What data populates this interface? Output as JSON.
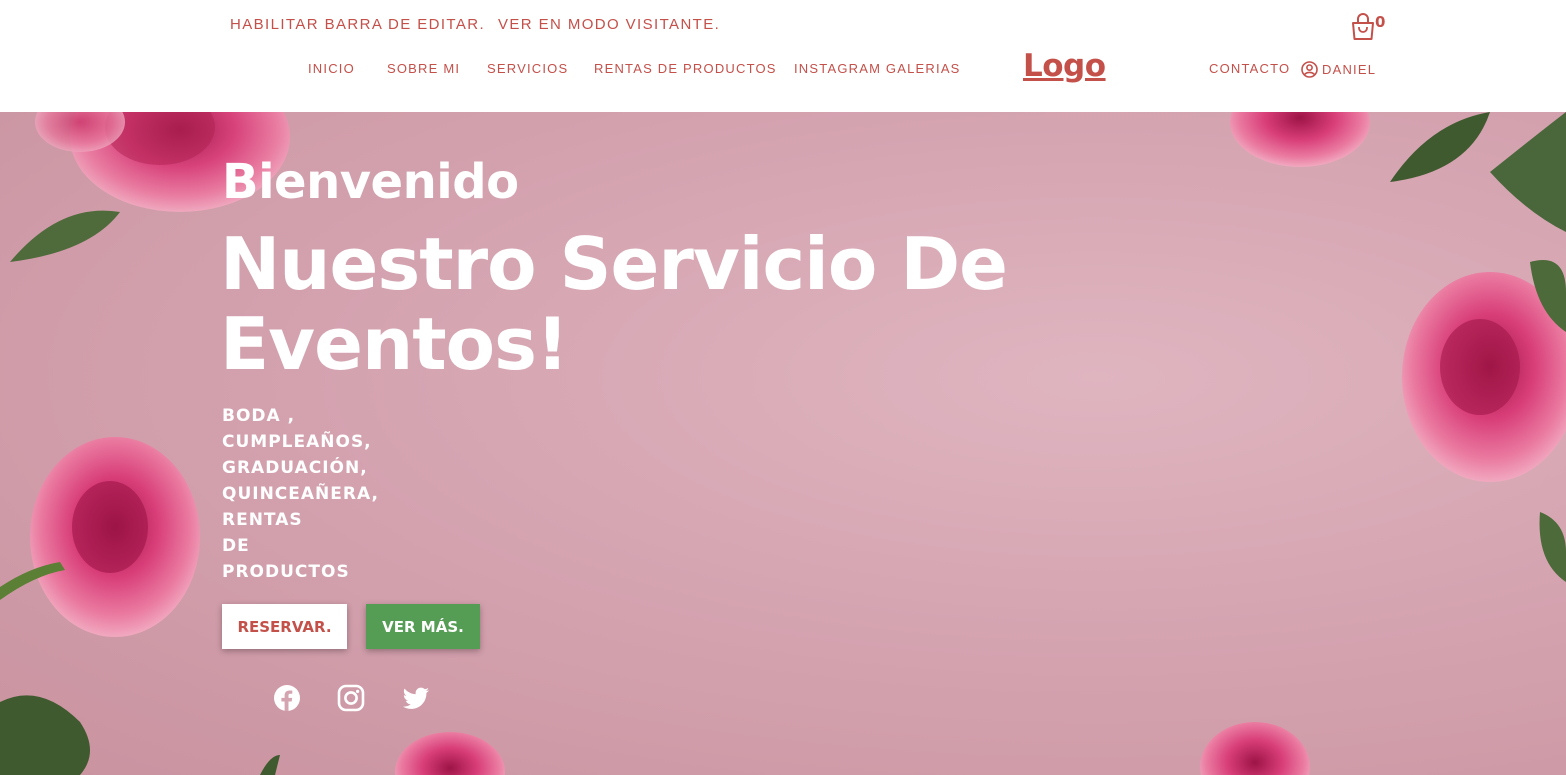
{
  "admin_bar": {
    "edit_label": "HABILITAR BARRA DE EDITAR.",
    "visitor_label": "VER EN MODO VISITANTE."
  },
  "nav": {
    "items": [
      {
        "label": "INICIO"
      },
      {
        "label": "SOBRE MI"
      },
      {
        "label": "SERVICIOS"
      },
      {
        "label": "RENTAS DE PRODUCTOS"
      },
      {
        "label": "INSTAGRAM GALERIAS"
      }
    ],
    "logo": "Logo",
    "contact": "CONTACTO",
    "user": "DANIEL",
    "cart_count": "0"
  },
  "hero": {
    "welcome": "Bienvenido",
    "headline": "Nuestro Servicio De Eventos!",
    "events": [
      "BODA ,",
      "CUMPLEAÑOS,",
      "GRADUACIÓN,",
      "QUINCEAÑERA,",
      "RENTAS",
      "DE",
      "PRODUCTOS"
    ],
    "reserve_button": "RESERVAR.",
    "more_button": "VER MÁS.",
    "social": [
      "facebook-icon",
      "instagram-icon",
      "twitter-icon"
    ]
  },
  "colors": {
    "accent": "#c4504a",
    "green": "#559c55",
    "hero_pink": "#d5a4b1",
    "white": "#ffffff"
  }
}
